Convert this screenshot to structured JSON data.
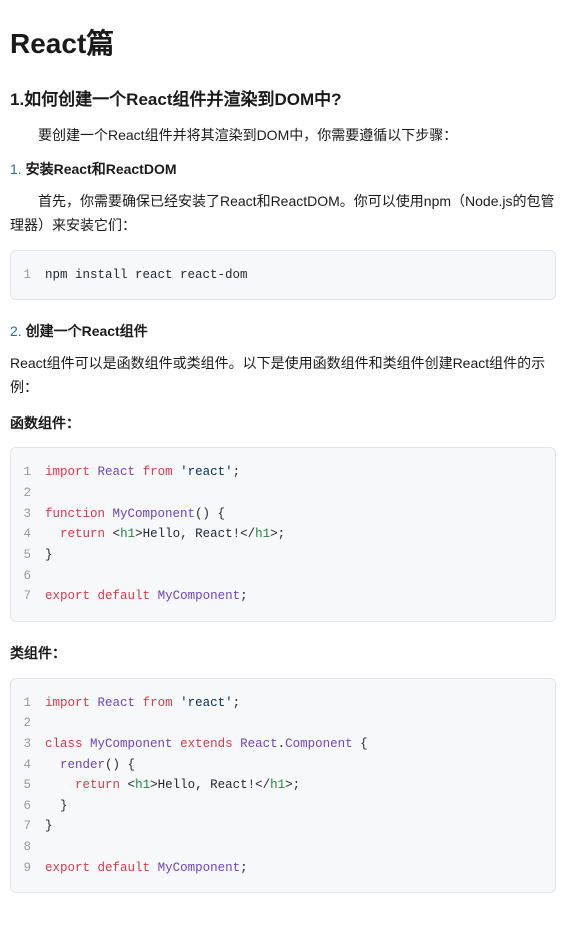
{
  "title": "React篇",
  "heading": "1.如何创建一个React组件并渲染到DOM中?",
  "intro": "要创建一个React组件并将其渲染到DOM中，你需要遵循以下步骤：",
  "step1": {
    "num": "1.",
    "title": "安装React和ReactDOM",
    "desc": "首先，你需要确保已经安装了React和ReactDOM。你可以使用npm（Node.js的包管理器）来安装它们："
  },
  "code_npm": {
    "lines": [
      {
        "ln": "1",
        "tokens": [
          {
            "c": "tk-plain",
            "t": "npm install react react-dom"
          }
        ]
      }
    ]
  },
  "step2": {
    "num": "2.",
    "title": "创建一个React组件",
    "desc": "React组件可以是函数组件或类组件。以下是使用函数组件和类组件创建React组件的示例："
  },
  "func_label": "函数组件：",
  "code_func": {
    "lines": [
      {
        "ln": "1",
        "tokens": [
          {
            "c": "tk-kw",
            "t": "import"
          },
          {
            "c": "tk-plain",
            "t": " "
          },
          {
            "c": "tk-cls",
            "t": "React"
          },
          {
            "c": "tk-plain",
            "t": " "
          },
          {
            "c": "tk-kw",
            "t": "from"
          },
          {
            "c": "tk-plain",
            "t": " "
          },
          {
            "c": "tk-str",
            "t": "'react'"
          },
          {
            "c": "tk-punct",
            "t": ";"
          }
        ]
      },
      {
        "ln": "2",
        "tokens": [
          {
            "c": "tk-plain",
            "t": ""
          }
        ]
      },
      {
        "ln": "3",
        "tokens": [
          {
            "c": "tk-kw",
            "t": "function"
          },
          {
            "c": "tk-plain",
            "t": " "
          },
          {
            "c": "tk-cls",
            "t": "MyComponent"
          },
          {
            "c": "tk-punct",
            "t": "() {"
          }
        ]
      },
      {
        "ln": "4",
        "tokens": [
          {
            "c": "tk-plain",
            "t": "  "
          },
          {
            "c": "tk-kw",
            "t": "return"
          },
          {
            "c": "tk-plain",
            "t": " "
          },
          {
            "c": "tk-punct",
            "t": "<"
          },
          {
            "c": "tk-tag",
            "t": "h1"
          },
          {
            "c": "tk-punct",
            "t": ">"
          },
          {
            "c": "tk-plain",
            "t": "Hello, React!"
          },
          {
            "c": "tk-punct",
            "t": "</"
          },
          {
            "c": "tk-tag",
            "t": "h1"
          },
          {
            "c": "tk-punct",
            "t": ">;"
          }
        ]
      },
      {
        "ln": "5",
        "tokens": [
          {
            "c": "tk-punct",
            "t": "}"
          }
        ]
      },
      {
        "ln": "6",
        "tokens": [
          {
            "c": "tk-plain",
            "t": ""
          }
        ]
      },
      {
        "ln": "7",
        "tokens": [
          {
            "c": "tk-kw",
            "t": "export"
          },
          {
            "c": "tk-plain",
            "t": " "
          },
          {
            "c": "tk-kw",
            "t": "default"
          },
          {
            "c": "tk-plain",
            "t": " "
          },
          {
            "c": "tk-cls",
            "t": "MyComponent"
          },
          {
            "c": "tk-punct",
            "t": ";"
          }
        ]
      }
    ]
  },
  "class_label": "类组件：",
  "code_class": {
    "lines": [
      {
        "ln": "1",
        "tokens": [
          {
            "c": "tk-kw",
            "t": "import"
          },
          {
            "c": "tk-plain",
            "t": " "
          },
          {
            "c": "tk-cls",
            "t": "React"
          },
          {
            "c": "tk-plain",
            "t": " "
          },
          {
            "c": "tk-kw",
            "t": "from"
          },
          {
            "c": "tk-plain",
            "t": " "
          },
          {
            "c": "tk-str",
            "t": "'react'"
          },
          {
            "c": "tk-punct",
            "t": ";"
          }
        ]
      },
      {
        "ln": "2",
        "tokens": [
          {
            "c": "tk-plain",
            "t": ""
          }
        ]
      },
      {
        "ln": "3",
        "tokens": [
          {
            "c": "tk-kw",
            "t": "class"
          },
          {
            "c": "tk-plain",
            "t": " "
          },
          {
            "c": "tk-cls",
            "t": "MyComponent"
          },
          {
            "c": "tk-plain",
            "t": " "
          },
          {
            "c": "tk-kw",
            "t": "extends"
          },
          {
            "c": "tk-plain",
            "t": " "
          },
          {
            "c": "tk-cls",
            "t": "React"
          },
          {
            "c": "tk-punct",
            "t": "."
          },
          {
            "c": "tk-cls",
            "t": "Component"
          },
          {
            "c": "tk-plain",
            "t": " "
          },
          {
            "c": "tk-punct",
            "t": "{"
          }
        ]
      },
      {
        "ln": "4",
        "tokens": [
          {
            "c": "tk-plain",
            "t": "  "
          },
          {
            "c": "tk-fn",
            "t": "render"
          },
          {
            "c": "tk-punct",
            "t": "() {"
          }
        ]
      },
      {
        "ln": "5",
        "tokens": [
          {
            "c": "tk-plain",
            "t": "    "
          },
          {
            "c": "tk-kw",
            "t": "return"
          },
          {
            "c": "tk-plain",
            "t": " "
          },
          {
            "c": "tk-punct",
            "t": "<"
          },
          {
            "c": "tk-tag",
            "t": "h1"
          },
          {
            "c": "tk-punct",
            "t": ">"
          },
          {
            "c": "tk-plain",
            "t": "Hello, React!"
          },
          {
            "c": "tk-punct",
            "t": "</"
          },
          {
            "c": "tk-tag",
            "t": "h1"
          },
          {
            "c": "tk-punct",
            "t": ">;"
          }
        ]
      },
      {
        "ln": "6",
        "tokens": [
          {
            "c": "tk-plain",
            "t": "  "
          },
          {
            "c": "tk-punct",
            "t": "}"
          }
        ]
      },
      {
        "ln": "7",
        "tokens": [
          {
            "c": "tk-punct",
            "t": "}"
          }
        ]
      },
      {
        "ln": "8",
        "tokens": [
          {
            "c": "tk-plain",
            "t": ""
          }
        ]
      },
      {
        "ln": "9",
        "tokens": [
          {
            "c": "tk-kw",
            "t": "export"
          },
          {
            "c": "tk-plain",
            "t": " "
          },
          {
            "c": "tk-kw",
            "t": "default"
          },
          {
            "c": "tk-plain",
            "t": " "
          },
          {
            "c": "tk-cls",
            "t": "MyComponent"
          },
          {
            "c": "tk-punct",
            "t": ";"
          }
        ]
      }
    ]
  }
}
